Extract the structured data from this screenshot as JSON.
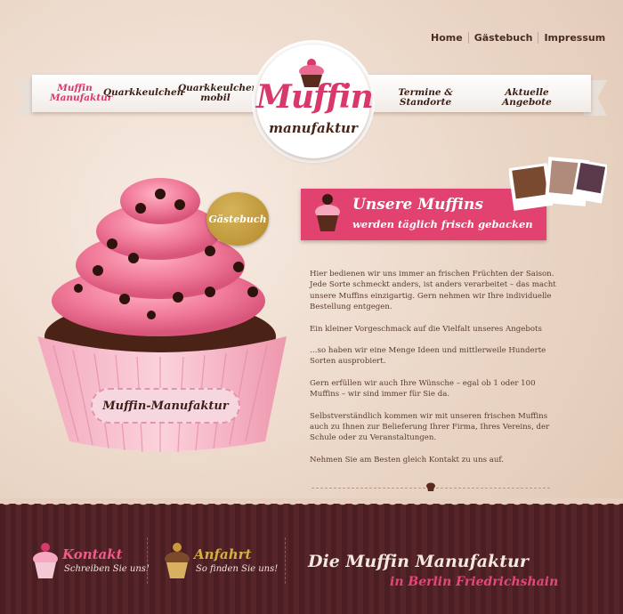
{
  "top_nav": {
    "items": [
      "Home",
      "Gästebuch",
      "Impressum"
    ]
  },
  "main_nav": {
    "left": [
      {
        "label": "Muffin Manufaktur",
        "active": true
      },
      {
        "label": "Quarkkeulchen",
        "active": false
      },
      {
        "label": "Quarkkeulchen mobil",
        "active": false
      }
    ],
    "right": [
      {
        "label": "Termine & Standorte"
      },
      {
        "label": "Aktuelle Angebote"
      }
    ]
  },
  "logo": {
    "title": "Muffin",
    "subtitle": "manufaktur"
  },
  "hero": {
    "guest_badge": "Gästebuch",
    "cup_label": "Muffin-Manufaktur"
  },
  "banner": {
    "title": "Unsere Muffins",
    "subtitle": "werden täglich frisch gebacken"
  },
  "content": {
    "paragraphs": [
      "Hier bedienen wir uns immer an frischen Früchten der Saison. Jede Sorte schmeckt anders, ist anders verarbeitet – das macht unsere Muffins einzigartig. Gern nehmen wir Ihre individuelle Bestellung entgegen.",
      "Ein kleiner Vorgeschmack auf die Vielfalt unseres Angebots",
      "…so haben wir eine Menge Ideen und mittlerweile Hunderte Sorten ausprobiert.",
      "Gern erfüllen wir auch Ihre Wünsche – egal ob 1 oder 100 Muffins – wir sind immer für Sie da.",
      "Selbstverständlich kommen wir mit unseren frischen Muffins auch zu Ihnen zur Belieferung Ihrer Firma, Ihres Vereins, der Schule oder zu Veranstaltungen.",
      "Nehmen Sie am Besten gleich Kontakt zu uns auf."
    ]
  },
  "footer": {
    "contact": {
      "title": "Kontakt",
      "subtitle": "Schreiben Sie uns!"
    },
    "directions": {
      "title": "Anfahrt",
      "subtitle": "So finden Sie uns!"
    },
    "brand": {
      "title": "Die Muffin Manufaktur",
      "subtitle": "in Berlin Friedrichshain"
    }
  },
  "colors": {
    "accent_pink": "#d8386a",
    "gold": "#d4b140",
    "footer_bg": "#4a1e22"
  }
}
